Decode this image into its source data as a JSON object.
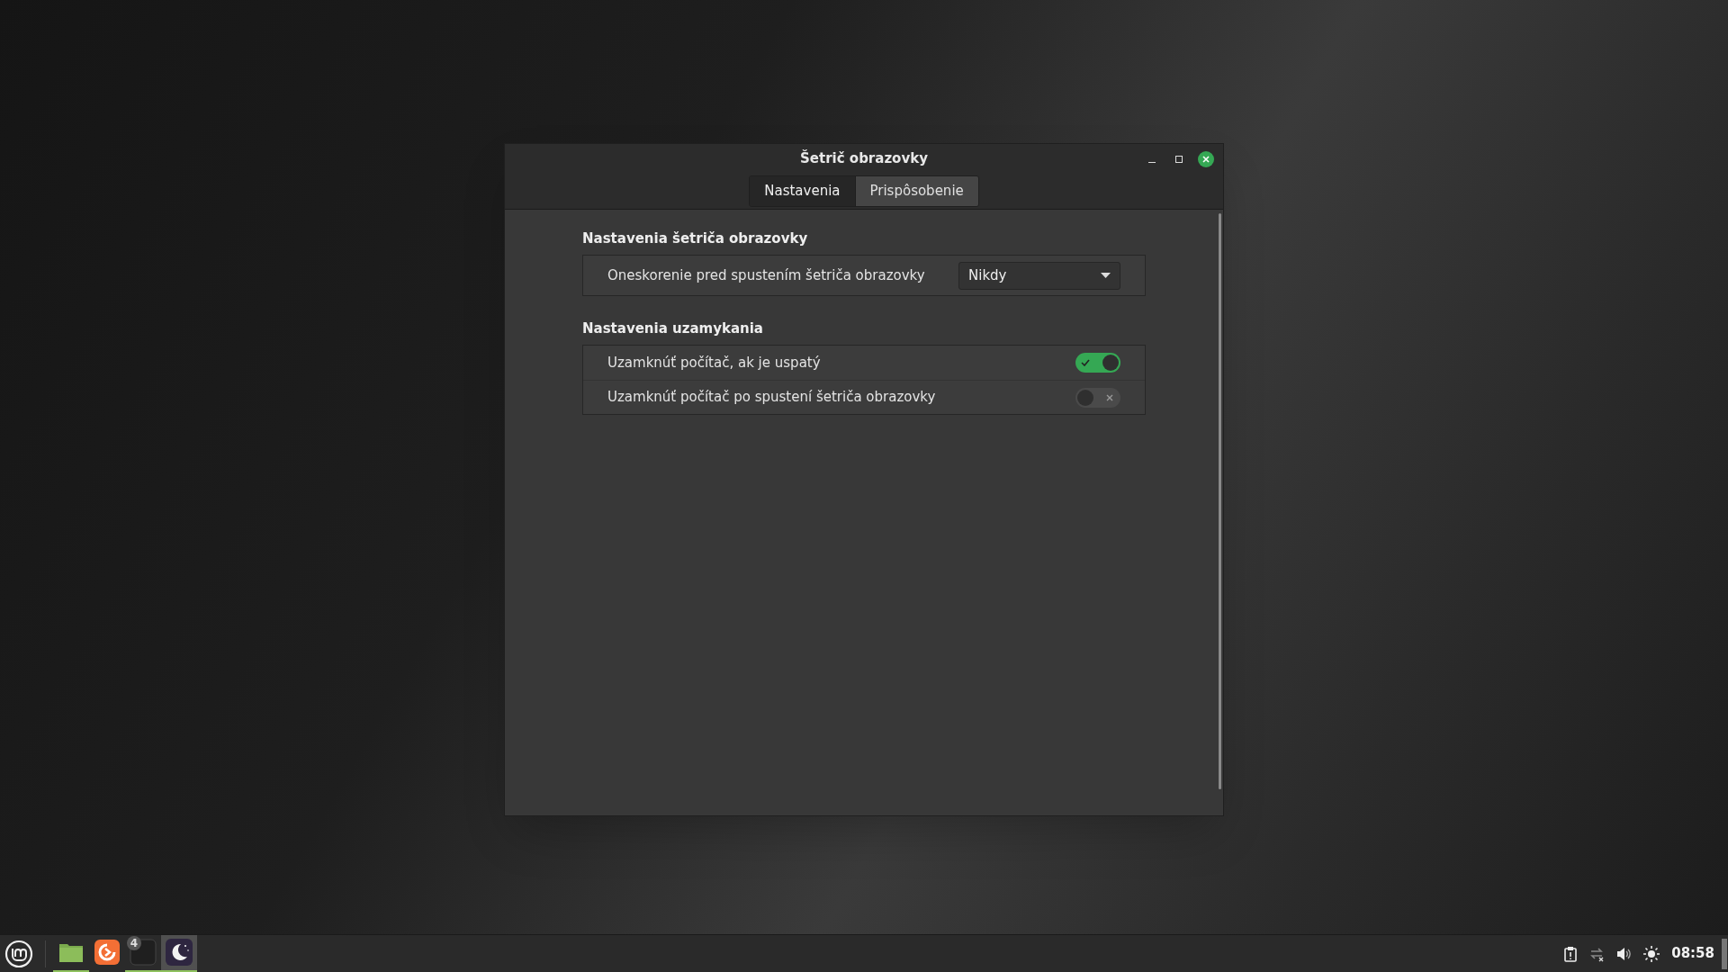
{
  "window": {
    "title": "Šetrič obrazovky"
  },
  "tabs": [
    {
      "label": "Nastavenia",
      "selected": true
    },
    {
      "label": "Prispôsobenie",
      "selected": false
    }
  ],
  "sections": [
    {
      "title": "Nastavenia šetriča obrazovky",
      "rows": [
        {
          "kind": "dropdown",
          "label": "Oneskorenie pred spustením šetriča obrazovky",
          "value": "Nikdy"
        }
      ]
    },
    {
      "title": "Nastavenia uzamykania",
      "rows": [
        {
          "kind": "switch",
          "label": "Uzamknúť počítač, ak je uspatý",
          "on": true
        },
        {
          "kind": "switch",
          "label": "Uzamknúť počítač po spustení šetriča obrazovky",
          "on": false
        }
      ]
    }
  ],
  "taskbar": {
    "apps": [
      {
        "kind": "files",
        "running": true,
        "focused": false
      },
      {
        "kind": "firefox",
        "running": false,
        "focused": false
      },
      {
        "kind": "terminal",
        "running": true,
        "focused": false,
        "badge": "4"
      },
      {
        "kind": "screensaver",
        "running": true,
        "focused": true
      }
    ],
    "clock": "08:58"
  }
}
